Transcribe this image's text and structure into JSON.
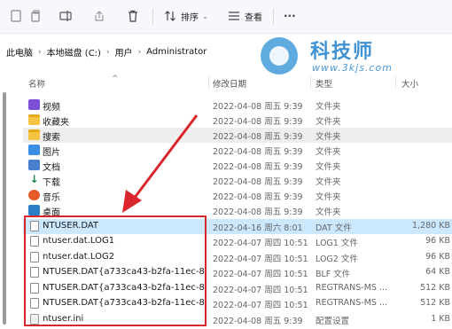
{
  "toolbar": {
    "sort_label": "排序",
    "view_label": "查看",
    "more_label": "···"
  },
  "breadcrumb": {
    "items": [
      "此电脑",
      "本地磁盘 (C:)",
      "用户",
      "Administrator"
    ]
  },
  "watermark": {
    "name": "科技师",
    "url": "www.3kjs.com"
  },
  "columns": {
    "name": "名称",
    "date": "修改日期",
    "type": "类型",
    "size": "大小"
  },
  "files": [
    {
      "name": "视频",
      "date": "2022-04-08 周五 9:39",
      "type": "文件夹",
      "size": ""
    },
    {
      "name": "收藏夹",
      "date": "2022-04-08 周五 9:39",
      "type": "文件夹",
      "size": ""
    },
    {
      "name": "搜索",
      "date": "2022-04-08 周五 9:39",
      "type": "文件夹",
      "size": ""
    },
    {
      "name": "图片",
      "date": "2022-04-08 周五 9:39",
      "type": "文件夹",
      "size": ""
    },
    {
      "name": "文档",
      "date": "2022-04-08 周五 9:39",
      "type": "文件夹",
      "size": ""
    },
    {
      "name": "下载",
      "date": "2022-04-08 周五 9:39",
      "type": "文件夹",
      "size": ""
    },
    {
      "name": "音乐",
      "date": "2022-04-08 周五 9:39",
      "type": "文件夹",
      "size": ""
    },
    {
      "name": "桌面",
      "date": "2022-04-08 周五 9:39",
      "type": "文件夹",
      "size": ""
    },
    {
      "name": "NTUSER.DAT",
      "date": "2022-04-16 周六 8:01",
      "type": "DAT 文件",
      "size": "1,280 KB"
    },
    {
      "name": "ntuser.dat.LOG1",
      "date": "2022-04-07 周四 10:51",
      "type": "LOG1 文件",
      "size": "96 KB"
    },
    {
      "name": "ntuser.dat.LOG2",
      "date": "2022-04-07 周四 10:51",
      "type": "LOG2 文件",
      "size": "96 KB"
    },
    {
      "name": "NTUSER.DAT{a733ca43-b2fa-11ec-85...",
      "date": "2022-04-07 周四 10:51",
      "type": "BLF 文件",
      "size": "64 KB"
    },
    {
      "name": "NTUSER.DAT{a733ca43-b2fa-11ec-85...",
      "date": "2022-04-07 周四 10:51",
      "type": "REGTRANS-MS ...",
      "size": "512 KB"
    },
    {
      "name": "NTUSER.DAT{a733ca43-b2fa-11ec-85...",
      "date": "2022-04-07 周四 10:51",
      "type": "REGTRANS-MS ...",
      "size": "512 KB"
    },
    {
      "name": "ntuser.ini",
      "date": "2022-04-08 周五 9:39",
      "type": "配置设置",
      "size": "1 KB"
    }
  ]
}
